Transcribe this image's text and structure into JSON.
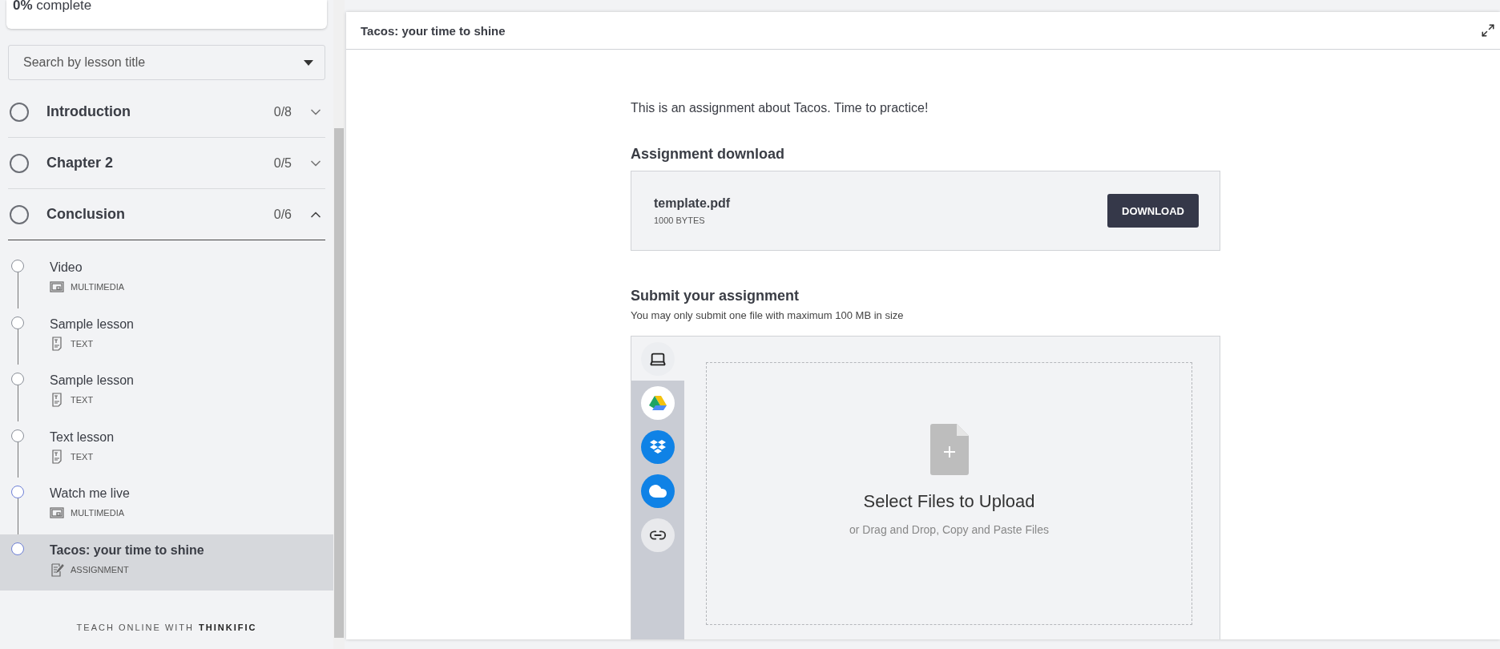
{
  "progress": {
    "label": "**0%** complete"
  },
  "search": {
    "placeholder": "Search by lesson title"
  },
  "chapters": [
    {
      "title": "Introduction",
      "count": "0/8",
      "expanded": false
    },
    {
      "title": "Chapter 2",
      "count": "0/5",
      "expanded": false
    },
    {
      "title": "Conclusion",
      "count": "0/6",
      "expanded": true,
      "lessons": [
        {
          "title": "Video",
          "type": "MULTIMEDIA",
          "kind": "multimedia",
          "color": "#8a8f98",
          "selected": false
        },
        {
          "title": "Sample lesson",
          "type": "TEXT",
          "kind": "text",
          "color": "#8a8f98",
          "selected": false
        },
        {
          "title": "Sample lesson",
          "type": "TEXT",
          "kind": "text",
          "color": "#8a8f98",
          "selected": false
        },
        {
          "title": "Text lesson",
          "type": "TEXT",
          "kind": "text",
          "color": "#8a8f98",
          "selected": false
        },
        {
          "title": "Watch me live",
          "type": "MULTIMEDIA",
          "kind": "multimedia",
          "color": "#6d7fd6",
          "selected": false
        },
        {
          "title": "Tacos: your time to shine",
          "type": "ASSIGNMENT",
          "kind": "assignment",
          "color": "#6d7fd6",
          "selected": true
        }
      ]
    }
  ],
  "footer": {
    "prefix": "TEACH ONLINE WITH",
    "brand": "THINKIFIC"
  },
  "lesson": {
    "title": "Tacos: your time to shine",
    "intro": "This is an assignment about Tacos. Time to practice!",
    "download_heading": "Assignment download",
    "file": {
      "name": "template.pdf",
      "size": "1000 BYTES",
      "button": "DOWNLOAD"
    },
    "submit_heading": "Submit your assignment",
    "submit_note": "You may only submit one file with maximum 100 MB in size",
    "uploader": {
      "sources": [
        {
          "kind": "computer",
          "selected": true
        },
        {
          "kind": "drive",
          "selected": false
        },
        {
          "kind": "dropbox",
          "selected": false
        },
        {
          "kind": "cloud",
          "selected": false
        },
        {
          "kind": "link",
          "selected": false
        }
      ],
      "title": "Select Files to Upload",
      "hint": "or Drag and Drop, Copy and Paste Files"
    }
  }
}
